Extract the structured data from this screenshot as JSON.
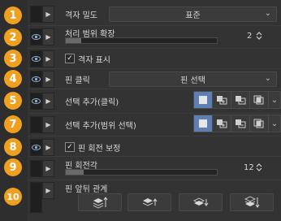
{
  "badges": [
    "1",
    "2",
    "3",
    "4",
    "5",
    "7",
    "8",
    "9",
    "10"
  ],
  "rows": {
    "grid_density": {
      "label": "격자 밀도",
      "value": "표준"
    },
    "processing_range": {
      "label": "처리 범위 확장",
      "value": "2",
      "fill": 0.1
    },
    "show_grid": {
      "label": "격자 표시",
      "checked": true
    },
    "pin_click": {
      "label": "핀 클릭",
      "value": "핀 선택"
    },
    "add_selection_click": {
      "label": "선택 추가(클릭)"
    },
    "add_selection_range": {
      "label": "선택 추가(범위 선택)"
    },
    "pin_rotation_correction": {
      "label": "핀 회전 보정",
      "checked": true
    },
    "pin_rotation_angle": {
      "label": "핀 회전각",
      "value": "12",
      "fill": 0.12
    },
    "pin_order": {
      "label": "핀 앞뒤 관계"
    }
  },
  "selection_modes": [
    "new-selection",
    "add-selection",
    "subtract-selection",
    "toggle-selection"
  ],
  "order_buttons": [
    "bring-to-front",
    "bring-forward",
    "send-backward",
    "send-to-back"
  ],
  "colors": {
    "badge": "#f0a020",
    "selected_mode": "#5d7fb3",
    "panel": "#333333"
  }
}
